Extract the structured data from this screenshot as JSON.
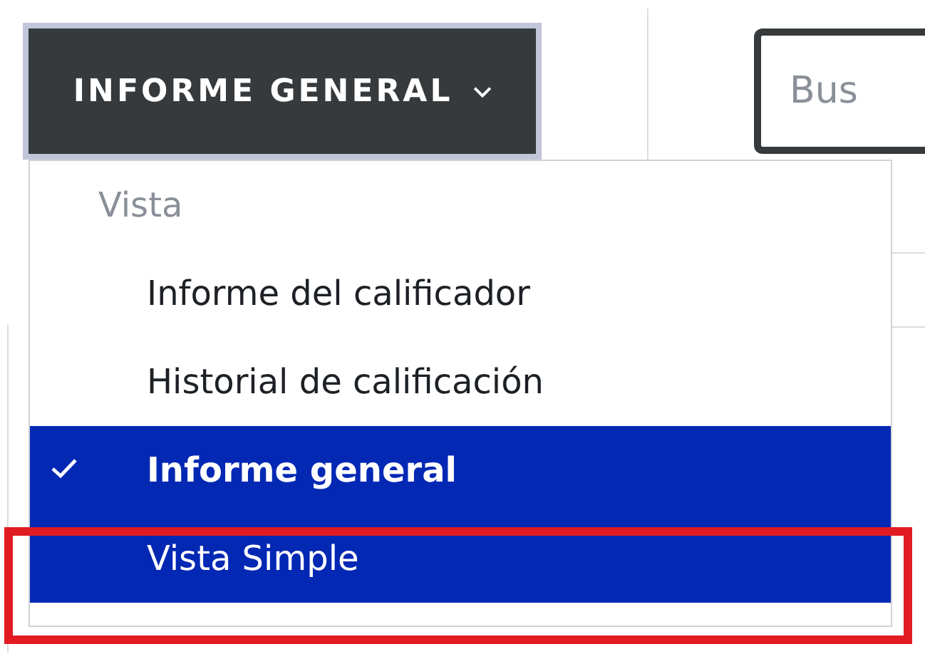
{
  "report_button": {
    "label": "INFORME GENERAL",
    "expanded": true
  },
  "search": {
    "placeholder": "Bus"
  },
  "menu": {
    "header": "Vista",
    "items": [
      {
        "label": "Informe del calificador",
        "selected": false,
        "highlighted": false
      },
      {
        "label": "Historial de calificación",
        "selected": false,
        "highlighted": false
      },
      {
        "label": "Informe general",
        "selected": true,
        "highlighted": true
      },
      {
        "label": "Vista Simple",
        "selected": false,
        "highlighted": true
      }
    ]
  }
}
